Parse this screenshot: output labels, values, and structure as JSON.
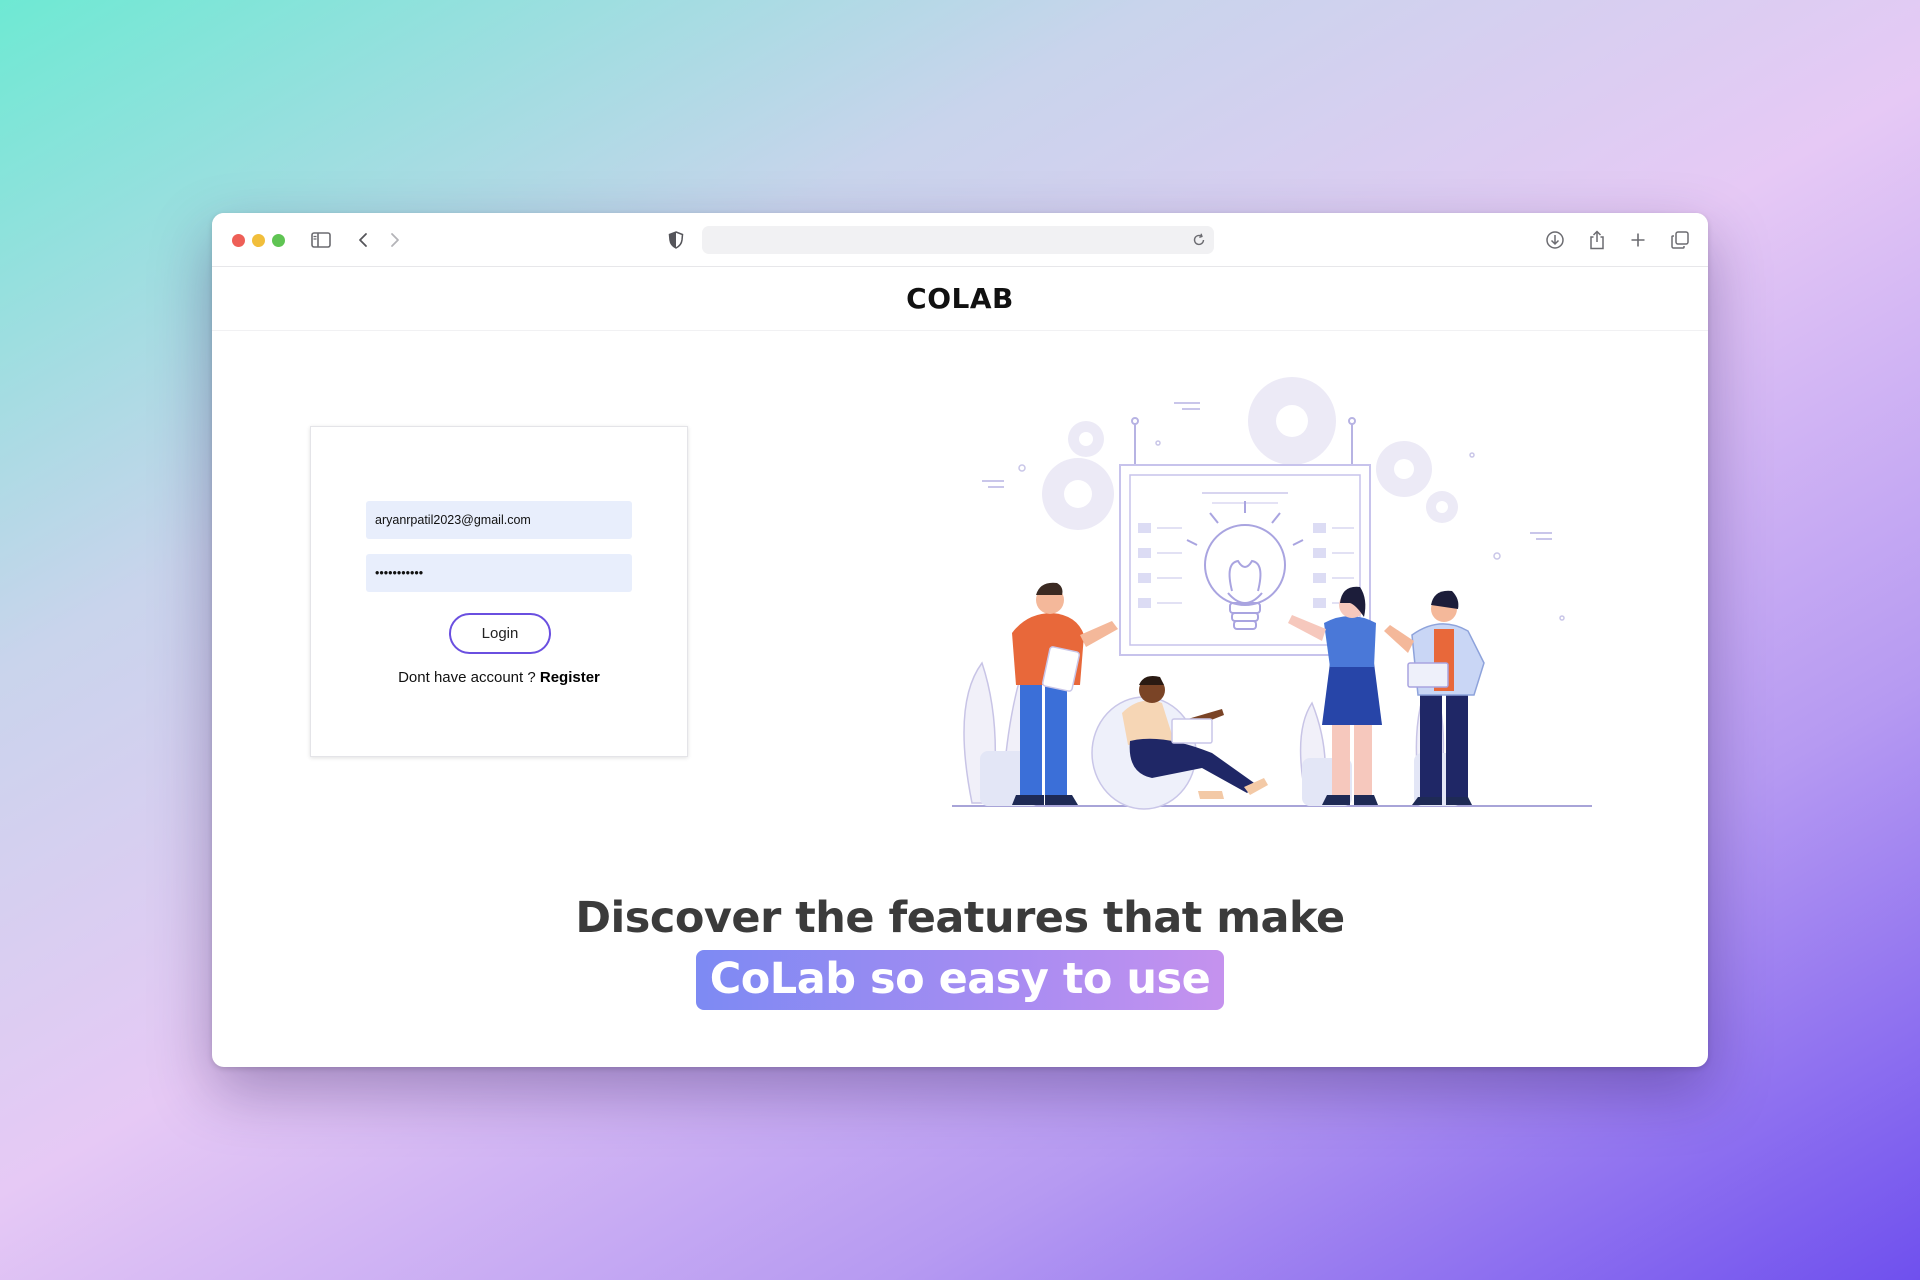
{
  "browser": {
    "address_value": "",
    "icons": [
      "sidebar-icon",
      "back-icon",
      "forward-icon",
      "shield-icon",
      "reload-icon",
      "download-icon",
      "share-icon",
      "new-tab-icon",
      "tabs-overview-icon"
    ]
  },
  "site": {
    "brand": "COLAB"
  },
  "login": {
    "email_value": "aryanrpatil2023@gmail.com",
    "password_value": "•••••••••••",
    "login_label": "Login",
    "no_account_text": "Dont have account ? ",
    "register_label": "Register"
  },
  "hero": {
    "line1": "Discover the features that make",
    "line2": "CoLab so easy to use"
  },
  "colors": {
    "accent": "#6a4fe0",
    "highlight_start": "#7d8af3",
    "highlight_end": "#c592ee",
    "input_bg": "#e8eefc"
  }
}
